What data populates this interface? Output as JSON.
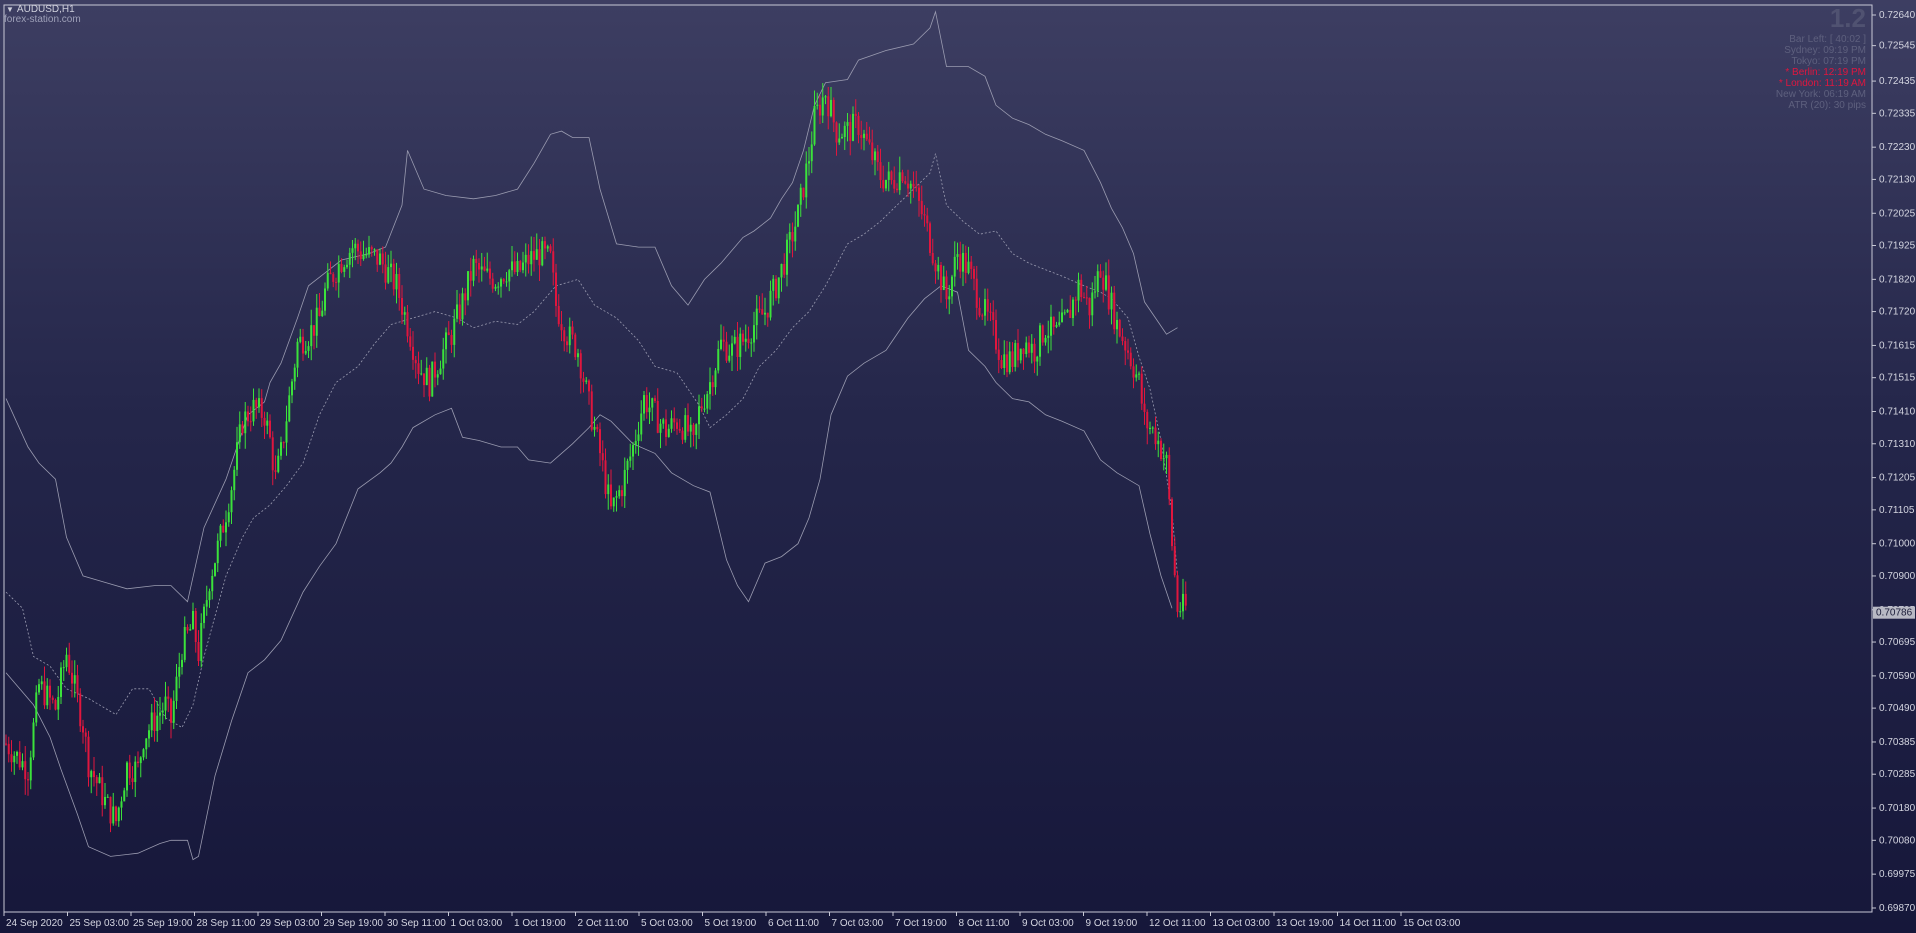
{
  "window": {
    "symbol_label": "AUDUSD,H1",
    "watermark": "forex-station.com"
  },
  "info_panel": {
    "version": "1.2",
    "rows": [
      {
        "label": "Bar Left",
        "value": "[ 40:02 ]",
        "highlight": false
      },
      {
        "label": "Sydney",
        "value": "09:19 PM",
        "highlight": false
      },
      {
        "label": "Tokyo",
        "value": "07:19 PM",
        "highlight": false
      },
      {
        "label": "* Berlin",
        "value": "12:19 PM",
        "highlight": true
      },
      {
        "label": "* London",
        "value": "11:19 AM",
        "highlight": true
      },
      {
        "label": "New York",
        "value": "06:19 AM",
        "highlight": false
      },
      {
        "label": "ATR (20)",
        "value": "30 pips",
        "highlight": false
      }
    ]
  },
  "colors": {
    "bull": "#3be23b",
    "bear": "#e0163e",
    "band": "#9a9bb0",
    "axis": "#d4d5e0"
  },
  "chart_data": {
    "type": "candlestick",
    "symbol": "AUDUSD",
    "timeframe": "H1",
    "ylim": [
      0.6987,
      0.7264
    ],
    "price_ticks": [
      "0.72640",
      "0.72545",
      "0.72435",
      "0.72335",
      "0.72230",
      "0.72130",
      "0.72025",
      "0.71925",
      "0.71820",
      "0.71720",
      "0.71615",
      "0.71515",
      "0.71410",
      "0.71310",
      "0.71205",
      "0.71105",
      "0.71000",
      "0.70900",
      "0.70795",
      "0.70695",
      "0.70590",
      "0.70490",
      "0.70385",
      "0.70285",
      "0.70180",
      "0.70080",
      "0.69975",
      "0.69870"
    ],
    "current_price": "0.70786",
    "time_ticks": [
      "24 Sep 2020",
      "25 Sep 03:00",
      "25 Sep 19:00",
      "28 Sep 11:00",
      "29 Sep 03:00",
      "29 Sep 19:00",
      "30 Sep 11:00",
      "1 Oct 03:00",
      "1 Oct 19:00",
      "2 Oct 11:00",
      "5 Oct 03:00",
      "5 Oct 19:00",
      "6 Oct 11:00",
      "7 Oct 03:00",
      "7 Oct 19:00",
      "8 Oct 11:00",
      "9 Oct 03:00",
      "9 Oct 19:00",
      "12 Oct 11:00",
      "13 Oct 03:00",
      "13 Oct 19:00",
      "14 Oct 11:00",
      "15 Oct 03:00"
    ],
    "close_path": [
      [
        0,
        0.7038
      ],
      [
        8,
        0.703
      ],
      [
        12,
        0.7056
      ],
      [
        18,
        0.7049
      ],
      [
        22,
        0.7066
      ],
      [
        28,
        0.7044
      ],
      [
        30,
        0.7032
      ],
      [
        36,
        0.702
      ],
      [
        40,
        0.7014
      ],
      [
        44,
        0.7031
      ],
      [
        48,
        0.703
      ],
      [
        50,
        0.704
      ],
      [
        56,
        0.7048
      ],
      [
        58,
        0.705
      ],
      [
        60,
        0.7045
      ],
      [
        64,
        0.7068
      ],
      [
        68,
        0.7075
      ],
      [
        70,
        0.7066
      ],
      [
        74,
        0.7089
      ],
      [
        78,
        0.7102
      ],
      [
        82,
        0.7118
      ],
      [
        86,
        0.7138
      ],
      [
        90,
        0.7142
      ],
      [
        94,
        0.714
      ],
      [
        96,
        0.7132
      ],
      [
        98,
        0.712
      ],
      [
        100,
        0.7128
      ],
      [
        106,
        0.7162
      ],
      [
        110,
        0.7165
      ],
      [
        114,
        0.717
      ],
      [
        116,
        0.7178
      ],
      [
        118,
        0.7182
      ],
      [
        122,
        0.7188
      ],
      [
        126,
        0.7192
      ],
      [
        130,
        0.719
      ],
      [
        134,
        0.7189
      ],
      [
        136,
        0.7188
      ],
      [
        142,
        0.718
      ],
      [
        146,
        0.7168
      ],
      [
        150,
        0.7155
      ],
      [
        154,
        0.715
      ],
      [
        158,
        0.7158
      ],
      [
        162,
        0.7165
      ],
      [
        166,
        0.7175
      ],
      [
        170,
        0.7186
      ],
      [
        174,
        0.7183
      ],
      [
        178,
        0.7182
      ],
      [
        182,
        0.7185
      ],
      [
        186,
        0.7184
      ],
      [
        190,
        0.7188
      ],
      [
        194,
        0.719
      ],
      [
        198,
        0.7188
      ],
      [
        200,
        0.7174
      ],
      [
        204,
        0.7165
      ],
      [
        208,
        0.716
      ],
      [
        212,
        0.7143
      ],
      [
        216,
        0.7128
      ],
      [
        220,
        0.711
      ],
      [
        224,
        0.7118
      ],
      [
        228,
        0.713
      ],
      [
        232,
        0.7145
      ],
      [
        236,
        0.714
      ],
      [
        240,
        0.7135
      ],
      [
        244,
        0.7138
      ],
      [
        248,
        0.7135
      ],
      [
        250,
        0.713
      ],
      [
        252,
        0.7141
      ],
      [
        256,
        0.715
      ],
      [
        260,
        0.7162
      ],
      [
        264,
        0.716
      ],
      [
        268,
        0.7163
      ],
      [
        272,
        0.7168
      ],
      [
        276,
        0.7172
      ],
      [
        280,
        0.718
      ],
      [
        284,
        0.719
      ],
      [
        288,
        0.7202
      ],
      [
        292,
        0.722
      ],
      [
        294,
        0.7232
      ],
      [
        298,
        0.724
      ],
      [
        302,
        0.7228
      ],
      [
        306,
        0.7228
      ],
      [
        310,
        0.723
      ],
      [
        314,
        0.7222
      ],
      [
        318,
        0.7214
      ],
      [
        322,
        0.7212
      ],
      [
        326,
        0.7216
      ],
      [
        330,
        0.721
      ],
      [
        334,
        0.72
      ],
      [
        338,
        0.7188
      ],
      [
        342,
        0.7176
      ],
      [
        346,
        0.719
      ],
      [
        350,
        0.7185
      ],
      [
        354,
        0.7175
      ],
      [
        358,
        0.7168
      ],
      [
        362,
        0.7158
      ],
      [
        366,
        0.7157
      ],
      [
        370,
        0.7163
      ],
      [
        374,
        0.716
      ],
      [
        378,
        0.7167
      ],
      [
        382,
        0.7165
      ],
      [
        386,
        0.717
      ],
      [
        390,
        0.718
      ],
      [
        394,
        0.7173
      ],
      [
        398,
        0.7186
      ],
      [
        400,
        0.718
      ],
      [
        404,
        0.7168
      ],
      [
        408,
        0.716
      ],
      [
        412,
        0.715
      ],
      [
        414,
        0.7138
      ],
      [
        418,
        0.7134
      ],
      [
        422,
        0.7125
      ],
      [
        424,
        0.71
      ],
      [
        426,
        0.708
      ]
    ],
    "bands": {
      "upper": [
        [
          0,
          0.7145
        ],
        [
          8,
          0.713
        ],
        [
          12,
          0.7125
        ],
        [
          18,
          0.712
        ],
        [
          22,
          0.7102
        ],
        [
          28,
          0.709
        ],
        [
          36,
          0.7088
        ],
        [
          44,
          0.7086
        ],
        [
          54,
          0.7087
        ],
        [
          60,
          0.7087
        ],
        [
          66,
          0.7082
        ],
        [
          72,
          0.7105
        ],
        [
          80,
          0.712
        ],
        [
          88,
          0.714
        ],
        [
          94,
          0.7144
        ],
        [
          96,
          0.715
        ],
        [
          100,
          0.7156
        ],
        [
          106,
          0.717
        ],
        [
          110,
          0.718
        ],
        [
          116,
          0.7184
        ],
        [
          122,
          0.7188
        ],
        [
          132,
          0.719
        ],
        [
          138,
          0.7192
        ],
        [
          144,
          0.7205
        ],
        [
          146,
          0.7222
        ],
        [
          152,
          0.721
        ],
        [
          160,
          0.7208
        ],
        [
          170,
          0.7207
        ],
        [
          178,
          0.7208
        ],
        [
          186,
          0.721
        ],
        [
          192,
          0.7218
        ],
        [
          198,
          0.7227
        ],
        [
          202,
          0.7228
        ],
        [
          206,
          0.7226
        ],
        [
          212,
          0.7226
        ],
        [
          216,
          0.721
        ],
        [
          222,
          0.7193
        ],
        [
          230,
          0.7192
        ],
        [
          236,
          0.7192
        ],
        [
          242,
          0.718
        ],
        [
          248,
          0.7174
        ],
        [
          254,
          0.7182
        ],
        [
          260,
          0.7187
        ],
        [
          268,
          0.7195
        ],
        [
          272,
          0.7197
        ],
        [
          278,
          0.7201
        ],
        [
          282,
          0.7207
        ],
        [
          286,
          0.7212
        ],
        [
          290,
          0.7222
        ],
        [
          294,
          0.7236
        ],
        [
          298,
          0.7243
        ],
        [
          306,
          0.7244
        ],
        [
          310,
          0.725
        ],
        [
          320,
          0.7253
        ],
        [
          330,
          0.7255
        ],
        [
          336,
          0.726
        ],
        [
          338,
          0.7265
        ],
        [
          342,
          0.7248
        ],
        [
          350,
          0.7248
        ],
        [
          356,
          0.7245
        ],
        [
          360,
          0.7236
        ],
        [
          366,
          0.7232
        ],
        [
          372,
          0.723
        ],
        [
          378,
          0.7227
        ],
        [
          384,
          0.7225
        ],
        [
          392,
          0.7222
        ],
        [
          398,
          0.7212
        ],
        [
          402,
          0.7204
        ],
        [
          406,
          0.7198
        ],
        [
          410,
          0.719
        ],
        [
          414,
          0.7175
        ],
        [
          418,
          0.717
        ],
        [
          422,
          0.7165
        ],
        [
          426,
          0.7167
        ]
      ],
      "middle": [
        [
          0,
          0.7085
        ],
        [
          6,
          0.708
        ],
        [
          10,
          0.7065
        ],
        [
          16,
          0.7062
        ],
        [
          22,
          0.7055
        ],
        [
          30,
          0.7052
        ],
        [
          40,
          0.7047
        ],
        [
          46,
          0.7055
        ],
        [
          52,
          0.7055
        ],
        [
          58,
          0.7046
        ],
        [
          64,
          0.7043
        ],
        [
          68,
          0.705
        ],
        [
          72,
          0.7065
        ],
        [
          80,
          0.709
        ],
        [
          86,
          0.7102
        ],
        [
          90,
          0.7108
        ],
        [
          96,
          0.7112
        ],
        [
          102,
          0.7118
        ],
        [
          108,
          0.7125
        ],
        [
          114,
          0.714
        ],
        [
          120,
          0.715
        ],
        [
          128,
          0.7155
        ],
        [
          134,
          0.7162
        ],
        [
          140,
          0.7168
        ],
        [
          148,
          0.717
        ],
        [
          156,
          0.7172
        ],
        [
          164,
          0.717
        ],
        [
          170,
          0.7167
        ],
        [
          178,
          0.7169
        ],
        [
          186,
          0.7168
        ],
        [
          192,
          0.7172
        ],
        [
          200,
          0.718
        ],
        [
          208,
          0.7182
        ],
        [
          214,
          0.7174
        ],
        [
          222,
          0.717
        ],
        [
          230,
          0.7163
        ],
        [
          236,
          0.7155
        ],
        [
          244,
          0.7153
        ],
        [
          252,
          0.7143
        ],
        [
          256,
          0.7136
        ],
        [
          262,
          0.714
        ],
        [
          268,
          0.7145
        ],
        [
          274,
          0.7155
        ],
        [
          280,
          0.716
        ],
        [
          286,
          0.7167
        ],
        [
          292,
          0.7172
        ],
        [
          298,
          0.718
        ],
        [
          306,
          0.7193
        ],
        [
          312,
          0.7196
        ],
        [
          318,
          0.72
        ],
        [
          324,
          0.7205
        ],
        [
          330,
          0.721
        ],
        [
          336,
          0.7215
        ],
        [
          338,
          0.7221
        ],
        [
          342,
          0.7205
        ],
        [
          348,
          0.72
        ],
        [
          354,
          0.7196
        ],
        [
          360,
          0.7197
        ],
        [
          366,
          0.719
        ],
        [
          372,
          0.7187
        ],
        [
          378,
          0.7185
        ],
        [
          384,
          0.7183
        ],
        [
          392,
          0.718
        ],
        [
          398,
          0.7178
        ],
        [
          402,
          0.7176
        ],
        [
          408,
          0.717
        ],
        [
          412,
          0.7158
        ],
        [
          416,
          0.7148
        ],
        [
          420,
          0.7132
        ],
        [
          424,
          0.711
        ],
        [
          426,
          0.709
        ]
      ],
      "lower": [
        [
          0,
          0.706
        ],
        [
          10,
          0.705
        ],
        [
          16,
          0.704
        ],
        [
          20,
          0.703
        ],
        [
          26,
          0.7016
        ],
        [
          30,
          0.7006
        ],
        [
          38,
          0.7003
        ],
        [
          48,
          0.7004
        ],
        [
          56,
          0.7007
        ],
        [
          60,
          0.7008
        ],
        [
          66,
          0.7008
        ],
        [
          68,
          0.7002
        ],
        [
          70,
          0.7003
        ],
        [
          76,
          0.7028
        ],
        [
          82,
          0.7045
        ],
        [
          88,
          0.706
        ],
        [
          94,
          0.7064
        ],
        [
          100,
          0.707
        ],
        [
          108,
          0.7085
        ],
        [
          114,
          0.7093
        ],
        [
          120,
          0.71
        ],
        [
          128,
          0.7117
        ],
        [
          136,
          0.7122
        ],
        [
          140,
          0.7125
        ],
        [
          144,
          0.713
        ],
        [
          148,
          0.7136
        ],
        [
          156,
          0.714
        ],
        [
          162,
          0.7142
        ],
        [
          166,
          0.7133
        ],
        [
          172,
          0.7132
        ],
        [
          180,
          0.713
        ],
        [
          186,
          0.713
        ],
        [
          190,
          0.7126
        ],
        [
          198,
          0.7125
        ],
        [
          202,
          0.7128
        ],
        [
          206,
          0.7131
        ],
        [
          212,
          0.7136
        ],
        [
          216,
          0.714
        ],
        [
          220,
          0.7138
        ],
        [
          228,
          0.7131
        ],
        [
          236,
          0.7128
        ],
        [
          242,
          0.7122
        ],
        [
          250,
          0.7118
        ],
        [
          256,
          0.7116
        ],
        [
          262,
          0.7095
        ],
        [
          266,
          0.7087
        ],
        [
          270,
          0.7082
        ],
        [
          276,
          0.7094
        ],
        [
          282,
          0.7096
        ],
        [
          288,
          0.71
        ],
        [
          292,
          0.7108
        ],
        [
          296,
          0.712
        ],
        [
          300,
          0.714
        ],
        [
          306,
          0.7152
        ],
        [
          312,
          0.7156
        ],
        [
          320,
          0.716
        ],
        [
          328,
          0.717
        ],
        [
          334,
          0.7176
        ],
        [
          340,
          0.718
        ],
        [
          346,
          0.7178
        ],
        [
          350,
          0.716
        ],
        [
          356,
          0.7155
        ],
        [
          360,
          0.715
        ],
        [
          366,
          0.7145
        ],
        [
          372,
          0.7144
        ],
        [
          378,
          0.714
        ],
        [
          384,
          0.7138
        ],
        [
          392,
          0.7135
        ],
        [
          398,
          0.7126
        ],
        [
          404,
          0.7122
        ],
        [
          412,
          0.7118
        ],
        [
          416,
          0.7103
        ],
        [
          420,
          0.709
        ],
        [
          424,
          0.708
        ]
      ]
    },
    "grid": false,
    "legend": "none"
  }
}
